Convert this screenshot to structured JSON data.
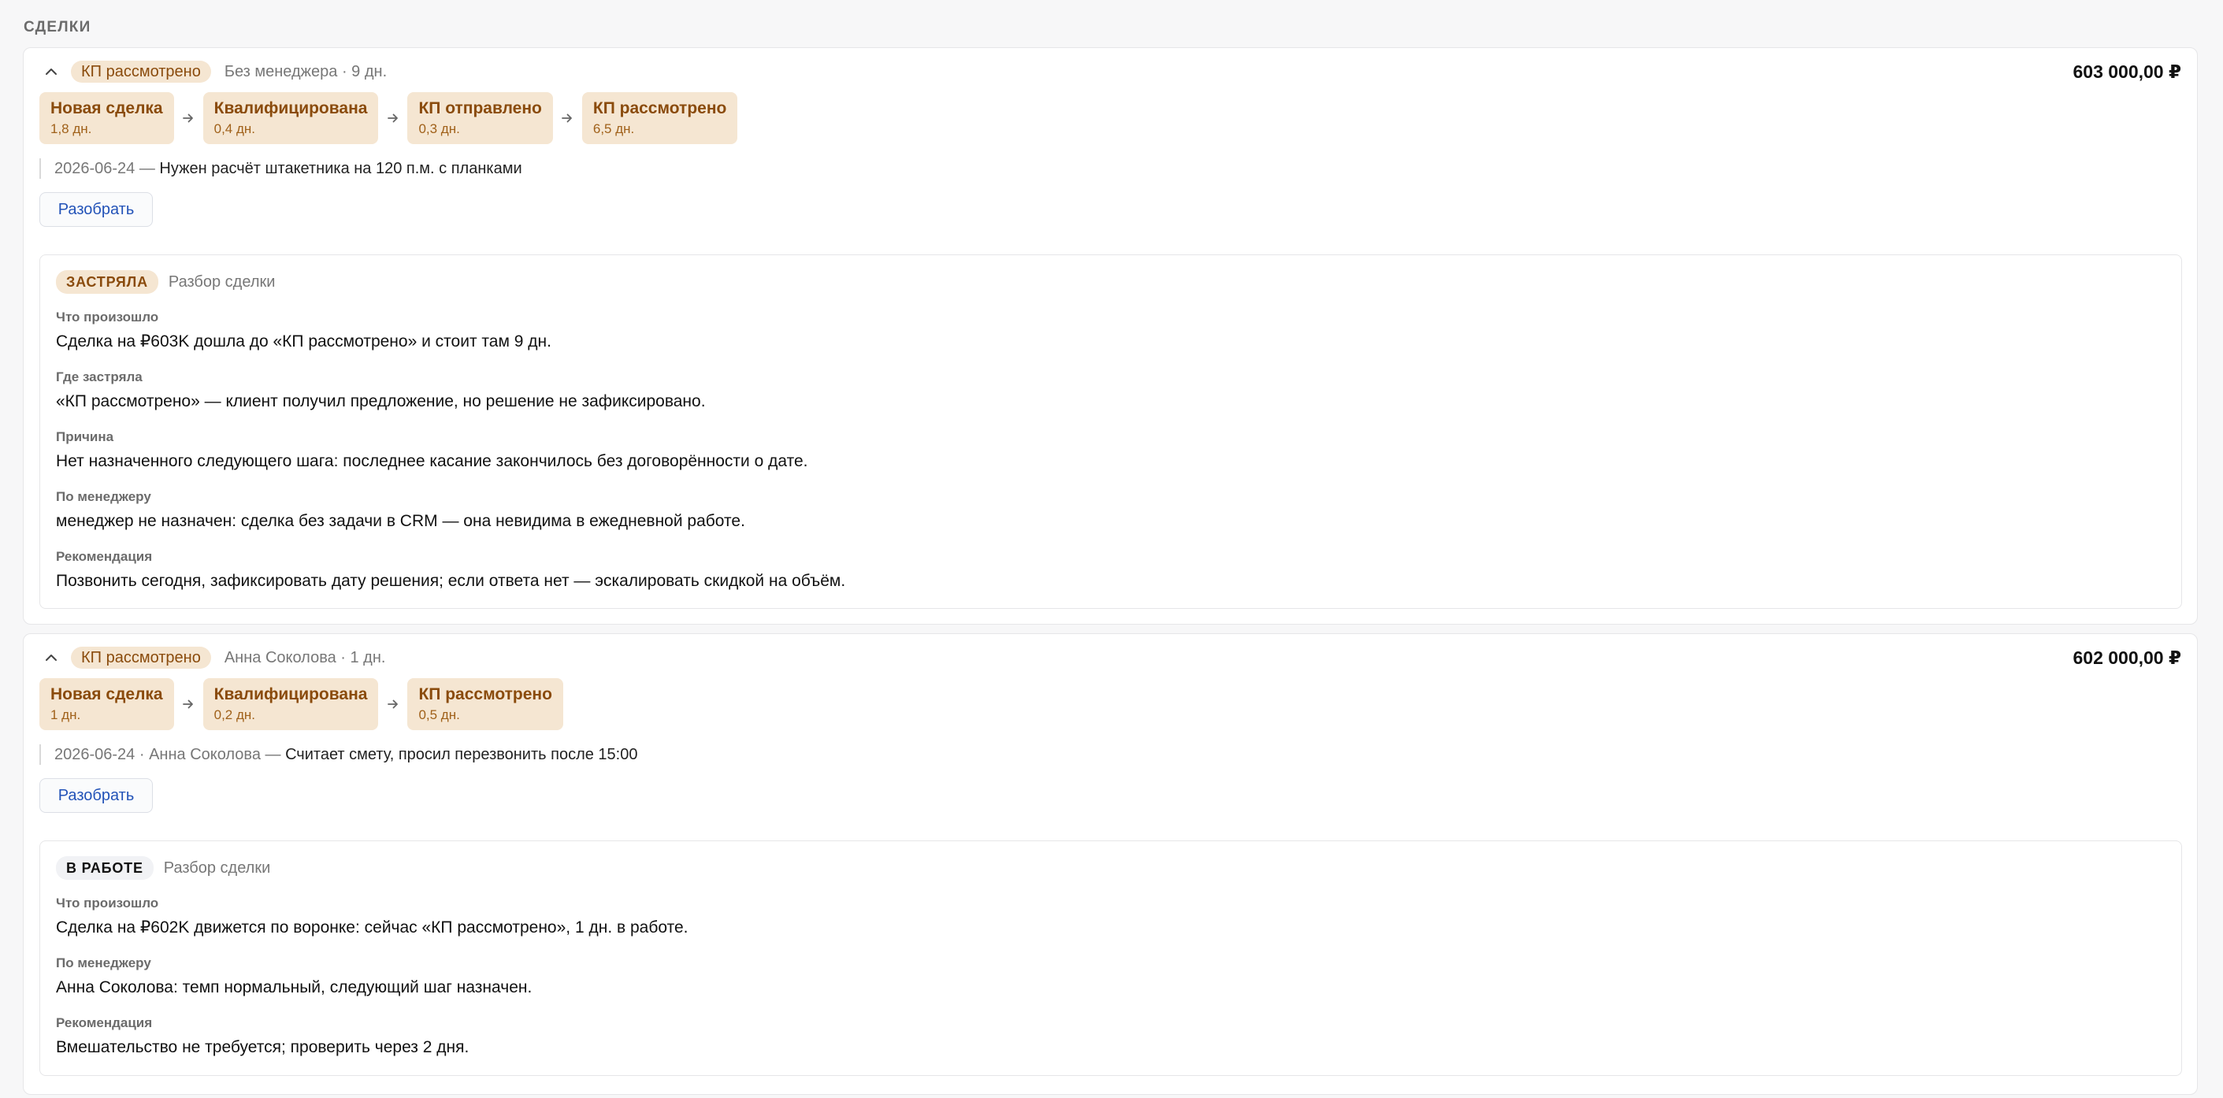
{
  "section_title": "СДЕЛКИ",
  "deals": [
    {
      "stage_badge": "КП рассмотрено",
      "meta": "Без менеджера · 9 дн.",
      "amount": "603 000,00 ₽",
      "pipeline": [
        {
          "name": "Новая сделка",
          "days": "1,8 дн."
        },
        {
          "name": "Квалифицирована",
          "days": "0,4 дн."
        },
        {
          "name": "КП отправлено",
          "days": "0,3 дн."
        },
        {
          "name": "КП рассмотрено",
          "days": "6,5 дн."
        }
      ],
      "note": {
        "prefix": "2026-06-24 — ",
        "text": "Нужен расчёт штакетника на 120 п.м. с планками"
      },
      "button": "Разобрать",
      "analysis": {
        "status": "ЗАСТРЯЛА",
        "title": "Разбор сделки",
        "fields": [
          {
            "label": "Что произошло",
            "value": "Сделка на ₽603K дошла до «КП рассмотрено» и стоит там 9 дн."
          },
          {
            "label": "Где застряла",
            "value": "«КП рассмотрено» — клиент получил предложение, но решение не зафиксировано."
          },
          {
            "label": "Причина",
            "value": "Нет назначенного следующего шага: последнее касание закончилось без договорённости о дате."
          },
          {
            "label": "По менеджеру",
            "value": "менеджер не назначен: сделка без задачи в CRM — она невидима в ежедневной работе."
          },
          {
            "label": "Рекомендация",
            "value": "Позвонить сегодня, зафиксировать дату решения; если ответа нет — эскалировать скидкой на объём."
          }
        ]
      }
    },
    {
      "stage_badge": "КП рассмотрено",
      "meta": "Анна Соколова · 1 дн.",
      "amount": "602 000,00 ₽",
      "pipeline": [
        {
          "name": "Новая сделка",
          "days": "1 дн."
        },
        {
          "name": "Квалифицирована",
          "days": "0,2 дн."
        },
        {
          "name": "КП рассмотрено",
          "days": "0,5 дн."
        }
      ],
      "note": {
        "prefix": "2026-06-24 · Анна Соколова — ",
        "text": "Считает смету, просил перезвонить после 15:00"
      },
      "button": "Разобрать",
      "analysis": {
        "status": "В РАБОТЕ",
        "title": "Разбор сделки",
        "fields": [
          {
            "label": "Что произошло",
            "value": "Сделка на ₽602K движется по воронке: сейчас «КП рассмотрено», 1 дн. в работе."
          },
          {
            "label": "По менеджеру",
            "value": "Анна Соколова: темп нормальный, следующий шаг назначен."
          },
          {
            "label": "Рекомендация",
            "value": "Вмешательство не требуется; проверить через 2 дня."
          }
        ]
      }
    }
  ]
}
